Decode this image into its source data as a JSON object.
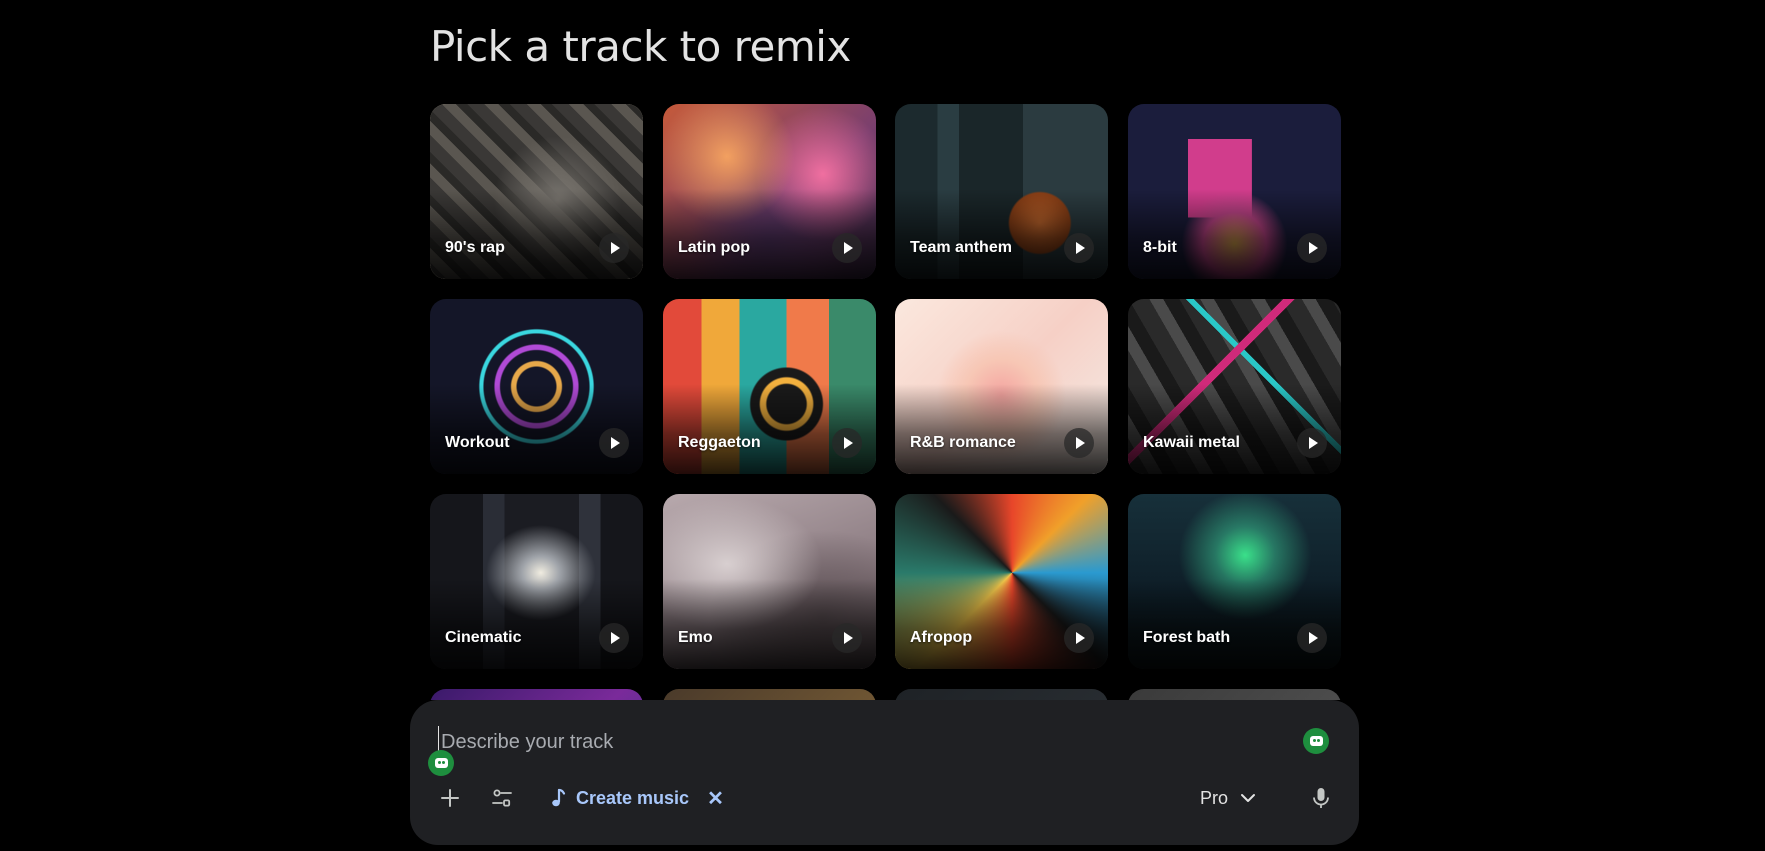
{
  "page": {
    "title": "Pick a track to remix"
  },
  "tracks": [
    {
      "label": "90's rap"
    },
    {
      "label": "Latin pop"
    },
    {
      "label": "Team anthem"
    },
    {
      "label": "8-bit"
    },
    {
      "label": "Workout"
    },
    {
      "label": "Reggaeton"
    },
    {
      "label": "R&B romance"
    },
    {
      "label": "Kawaii metal"
    },
    {
      "label": "Cinematic"
    },
    {
      "label": "Emo"
    },
    {
      "label": "Afropop"
    },
    {
      "label": "Forest bath"
    }
  ],
  "composer": {
    "placeholder": "Describe your track",
    "value": "",
    "tool_chip": {
      "label": "Create music",
      "icon": "music-note-icon",
      "close_icon": "close-icon"
    },
    "model": {
      "label": "Pro",
      "icon": "chevron-down-icon"
    },
    "buttons": {
      "add": "plus-icon",
      "tools": "tune-icon",
      "mic": "mic-icon"
    },
    "accent_color": "#a8c7fa",
    "badge_color": "#1e8e3e"
  }
}
